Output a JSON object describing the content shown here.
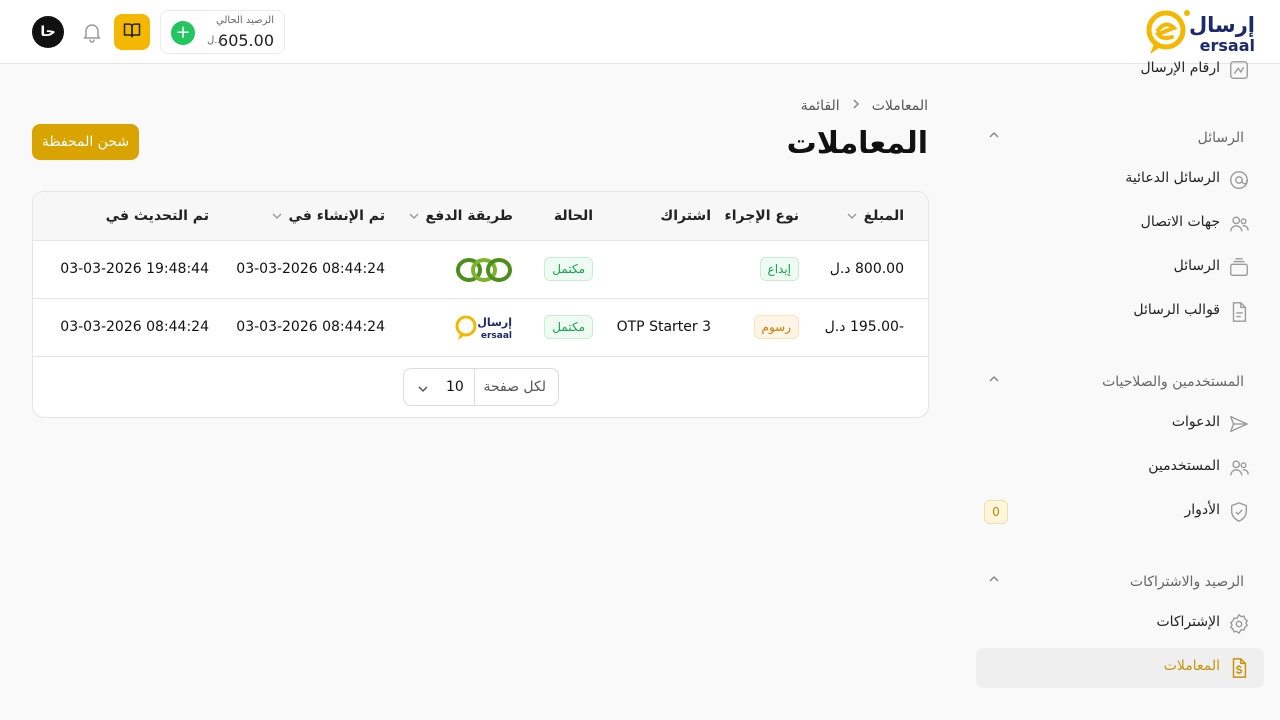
{
  "app": {
    "logo_text_ar": "إرسال",
    "logo_text_en": "ersaal"
  },
  "header": {
    "avatar_initials": "حا",
    "balance_label": "الرصيد الحالي",
    "balance_amount": "605.00",
    "balance_currency": "د.ل",
    "add_symbol": "+"
  },
  "sidebar": {
    "top_item": "ارقام الإرسال",
    "sections": [
      {
        "title": "الرسائل",
        "items": [
          "الرسائل الدعائية",
          "جهات الاتصال",
          "الرسائل",
          "قوالب الرسائل"
        ]
      },
      {
        "title": "المستخدمين والصلاحيات",
        "items": [
          "الدعوات",
          "المستخدمين",
          "الأدوار"
        ]
      },
      {
        "title": "الرصيد والاشتراكات",
        "items": [
          "الإشتراكات",
          "المعاملات"
        ]
      }
    ],
    "roles_badge": "0",
    "active_item": "المعاملات"
  },
  "main": {
    "breadcrumb": [
      "المعاملات",
      "القائمة"
    ],
    "title": "المعاملات",
    "topup_button": "شحن المحفظة"
  },
  "table": {
    "headers": {
      "amount": "المبلغ",
      "action_type": "نوع الإجراء",
      "subscription": "اشتراك",
      "status": "الحالة",
      "payment_method": "طريقة الدفع",
      "created_at": "تم الإنشاء في",
      "updated_at": "تم التحديث في"
    },
    "rows": [
      {
        "amount": "800.00 د.ل",
        "action_type": "إيداع",
        "action_color": "green",
        "subscription": "",
        "status": "مكتمل",
        "payment_method": "green-rings-logo",
        "created_at": "03-03-2026 08:44:24",
        "updated_at": "03-03-2026 19:48:44"
      },
      {
        "amount": "-195.00 د.ل",
        "action_type": "رسوم",
        "action_color": "orange",
        "subscription": "OTP Starter 3",
        "status": "مكتمل",
        "payment_method": "ersaal-logo",
        "created_at": "03-03-2026 08:44:24",
        "updated_at": "03-03-2026 08:44:24"
      }
    ],
    "per_page_label": "لكل صفحة",
    "per_page_value": "10"
  },
  "colors": {
    "accent": "#f5b800",
    "button": "#d9a300",
    "active_text": "#c9940a",
    "success": "#16a34a",
    "warning": "#d97706"
  }
}
